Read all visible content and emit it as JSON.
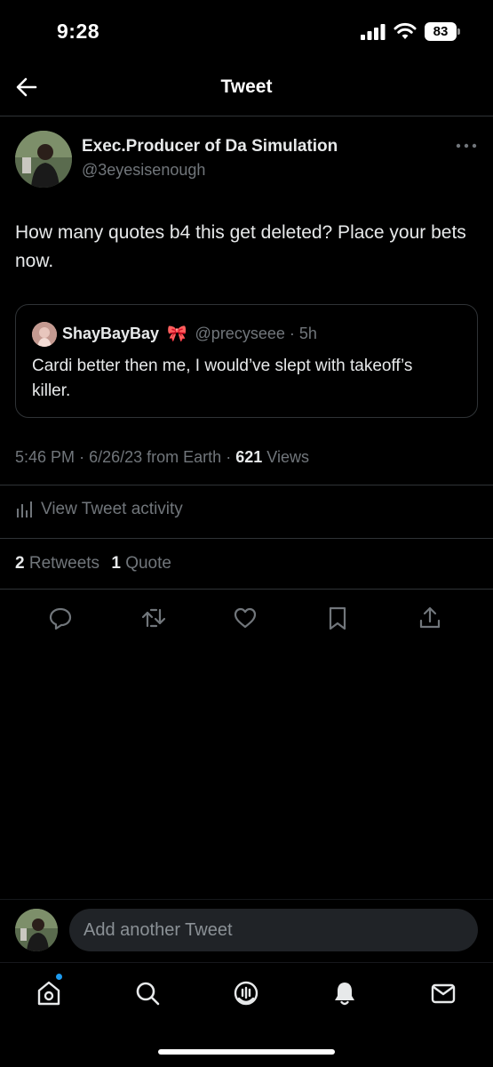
{
  "status": {
    "time": "9:28",
    "battery": "83"
  },
  "header": {
    "title": "Tweet"
  },
  "tweet": {
    "author_name": "Exec.Producer of Da Simulation",
    "author_handle": "@3eyesisenough",
    "text": "How many quotes b4 this get deleted? Place your bets now.",
    "quote": {
      "name": "ShayBayBay",
      "emoji": "🎀",
      "handle": "@precyseee",
      "sep": "·",
      "time": "5h",
      "text": "Cardi better then me, I would’ve slept with takeoff’s killer."
    },
    "meta_time": "5:46 PM",
    "meta_sep1": "·",
    "meta_date": "6/26/23 from Earth",
    "meta_sep2": "·",
    "views_count": "621",
    "views_label": "Views",
    "activity_label": "View Tweet activity",
    "retweets_count": "2",
    "retweets_label": "Retweets",
    "quotes_count": "1",
    "quotes_label": "Quote"
  },
  "reply": {
    "placeholder": "Add another Tweet"
  },
  "icons": {
    "back": "arrow-left-icon",
    "more": "more-dots-icon",
    "reply": "reply-icon",
    "retweet": "retweet-icon",
    "like": "heart-icon",
    "bookmark": "bookmark-icon",
    "share": "share-icon",
    "tabs": [
      "home-icon",
      "search-icon",
      "spaces-icon",
      "notifications-icon",
      "messages-icon"
    ]
  },
  "colors": {
    "background": "#000000",
    "text": "#e7e9ea",
    "muted": "#71767b",
    "accent": "#1d9bf0",
    "divider": "#2f3336"
  }
}
